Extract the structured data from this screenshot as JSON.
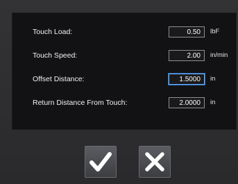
{
  "fields": [
    {
      "label": "Touch Load:",
      "value": "0.50",
      "unit": "lbF"
    },
    {
      "label": "Touch Speed:",
      "value": "2.00",
      "unit": "in/min"
    },
    {
      "label": "Offset Distance:",
      "value": "1.5000",
      "unit": "in"
    },
    {
      "label": "Return Distance From Touch:",
      "value": "2.0000",
      "unit": "in"
    }
  ],
  "buttons": {
    "confirm_icon": "checkmark-icon",
    "cancel_icon": "close-icon"
  },
  "colors": {
    "panel": "#121214",
    "active_field_border": "#6ab0ff",
    "button": "#4c4d52"
  }
}
